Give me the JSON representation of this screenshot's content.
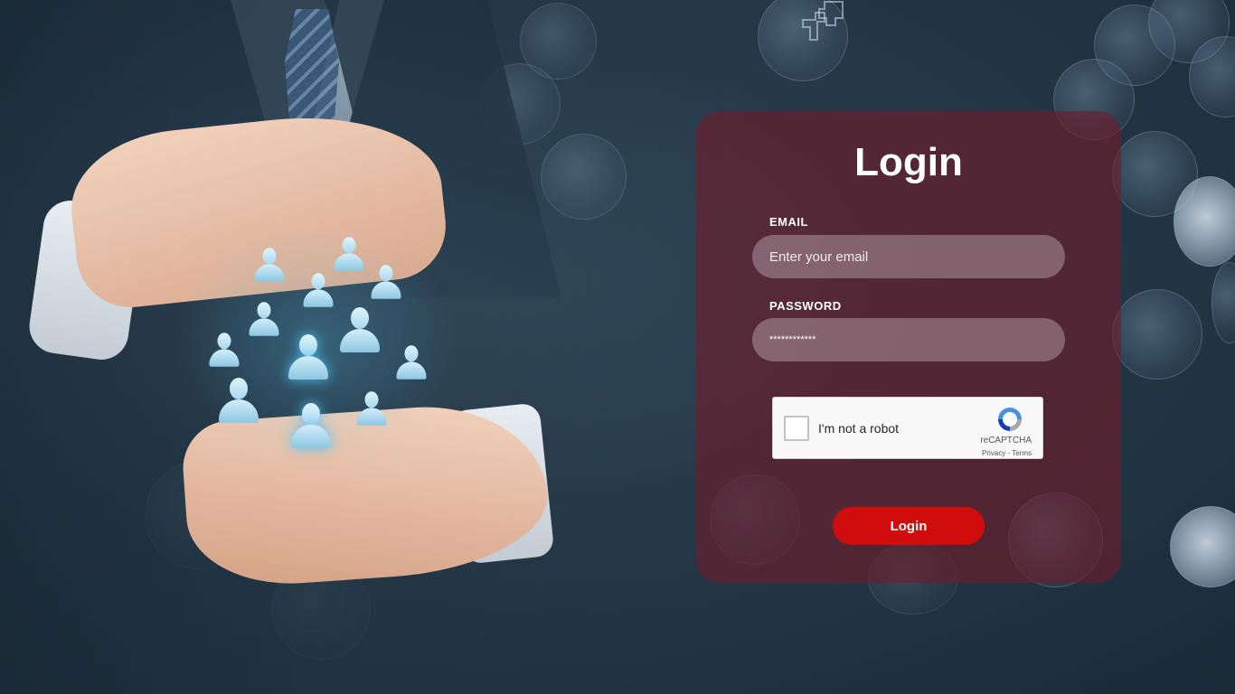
{
  "login": {
    "title": "Login",
    "email_label": "EMAIL",
    "email_placeholder": "Enter your email",
    "password_label": "PASSWORD",
    "password_value": "************",
    "submit_label": "Login"
  },
  "recaptcha": {
    "checkbox_label": "I'm not a robot",
    "brand": "reCAPTCHA",
    "privacy_link": "Privacy",
    "separator": "-",
    "terms_link": "Terms",
    "checked": false
  },
  "colors": {
    "card_background": "#701c2a",
    "login_button": "#d10c0c",
    "page_background": "#263a49",
    "people_icons_glow": "#5ac8f5"
  },
  "icons": {
    "background_people": "person-icon",
    "top_logo": "logo-mark-icon",
    "captcha": "recaptcha-icon"
  }
}
